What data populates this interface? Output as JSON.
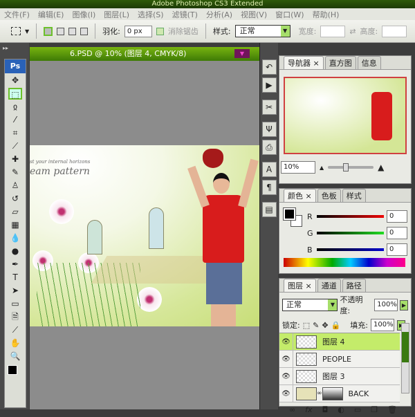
{
  "app": {
    "title": "Adobe Photoshop CS3 Extended",
    "logo": "Ps"
  },
  "menu": [
    "文件(F)",
    "编辑(E)",
    "图像(I)",
    "图层(L)",
    "选择(S)",
    "滤镜(T)",
    "分析(A)",
    "视图(V)",
    "窗口(W)",
    "帮助(H)"
  ],
  "options": {
    "feather_label": "羽化:",
    "feather_value": "0 px",
    "antialias_label": "消除锯齿",
    "style_label": "样式:",
    "style_value": "正常",
    "width_label": "宽度:",
    "height_label": "高度:"
  },
  "document": {
    "title": "6.PSD @ 10% (图层 4, CMYK/8)",
    "canvas_text_1": "st your internal horizons",
    "canvas_text_2": "eam pattern"
  },
  "navigator": {
    "tabs": [
      "导航器",
      "直方图",
      "信息"
    ],
    "zoom": "10%"
  },
  "color": {
    "tabs": [
      "颜色",
      "色板",
      "样式"
    ],
    "r_label": "R",
    "g_label": "G",
    "b_label": "B",
    "r": "0",
    "g": "0",
    "b": "0"
  },
  "layers": {
    "tabs": [
      "图层",
      "通道",
      "路径"
    ],
    "blend": "正常",
    "opacity_label": "不透明度:",
    "opacity": "100%",
    "lock_label": "锁定:",
    "fill_label": "填充:",
    "fill": "100%",
    "items": [
      {
        "name": "图层 4"
      },
      {
        "name": "PEOPLE"
      },
      {
        "name": "图层 3"
      },
      {
        "name": "BACK"
      }
    ]
  },
  "colors": {
    "accent": "#c4ec6a",
    "titlebar": "#2f5a0a"
  }
}
